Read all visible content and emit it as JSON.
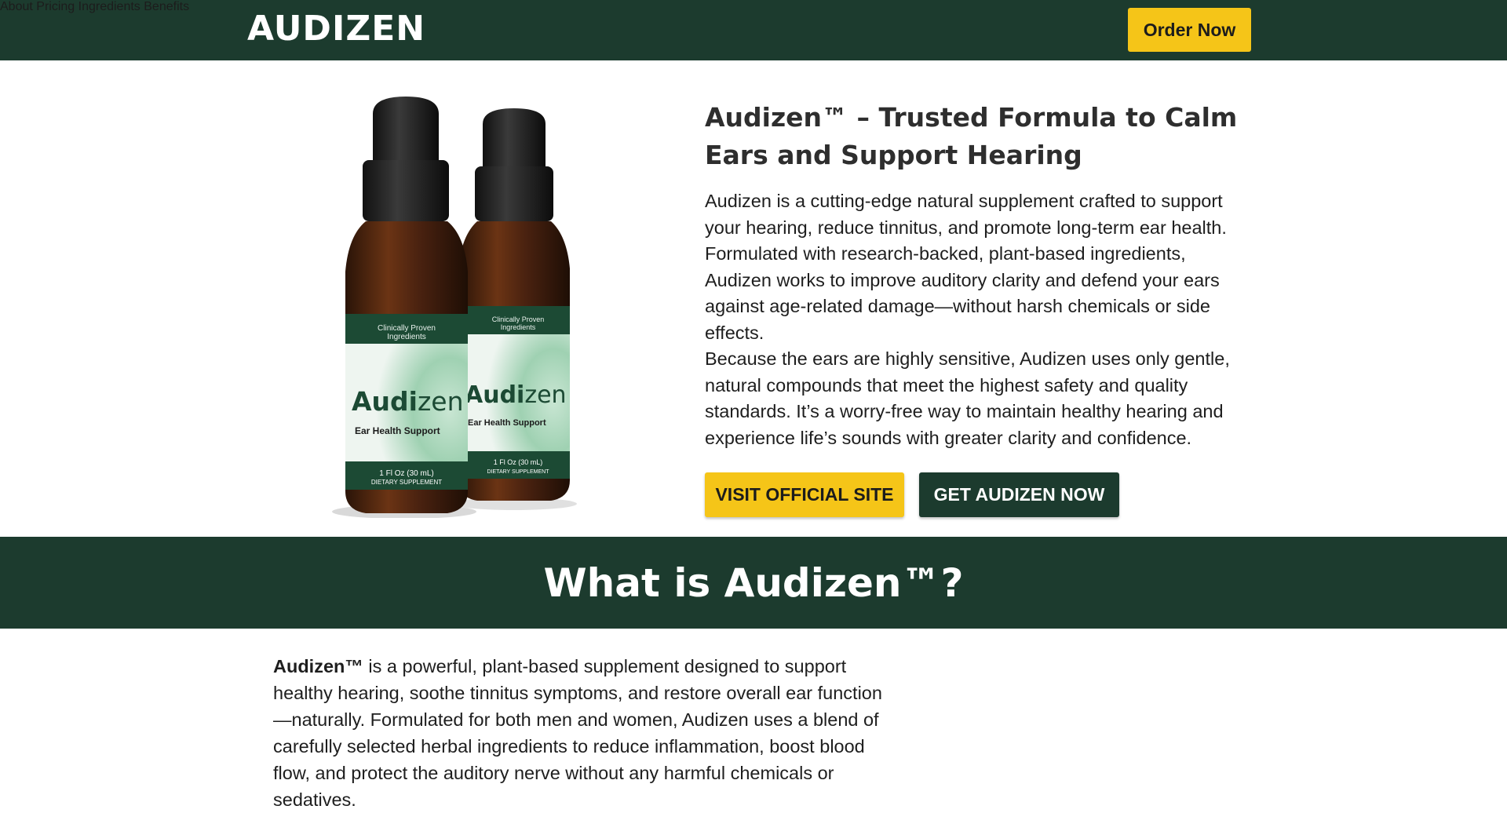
{
  "header": {
    "logo": "AUDIZEN",
    "nav": [
      "About",
      "Pricing",
      "Ingredients",
      "Benefits"
    ],
    "order_label": "Order Now"
  },
  "product_image": {
    "badge_text": "Clinically Proven Ingredients",
    "brand_a": "Audi",
    "brand_b": "zen",
    "subtitle": "Ear Health Support",
    "size": "1 Fl Oz (30 mL)",
    "type": "DIETARY SUPPLEMENT"
  },
  "hero": {
    "title": "Audizen™ – Trusted Formula to Calm Ears and Support Hearing",
    "p1": "Audizen is a cutting-edge natural supplement crafted to support your hearing, reduce tinnitus, and promote long-term ear health. Formulated with research-backed, plant-based ingredients, Audizen works to improve auditory clarity and defend your ears against age-related damage—without harsh chemicals or side effects.",
    "p2": "Because the ears are highly sensitive, Audizen uses only gentle, natural compounds that meet the highest safety and quality standards. It’s a worry-free way to maintain healthy hearing and experience life’s sounds with greater clarity and confidence.",
    "btn_visit": "VISIT OFFICIAL SITE",
    "btn_get": "GET AUDIZEN NOW"
  },
  "section": {
    "title": "What is Audizen™?",
    "lead_bold": "Audizen™",
    "lead_text": " is a powerful, plant-based supplement designed to support healthy hearing, soothe tinnitus symptoms, and restore overall ear function—naturally. Formulated for both men and women, Audizen uses a blend of carefully selected herbal ingredients to reduce inflammation, boost blood flow, and protect the auditory nerve without any harmful chemicals or sedatives."
  },
  "colors": {
    "brand_green": "#1c3b2e",
    "accent_yellow": "#f5c518"
  }
}
